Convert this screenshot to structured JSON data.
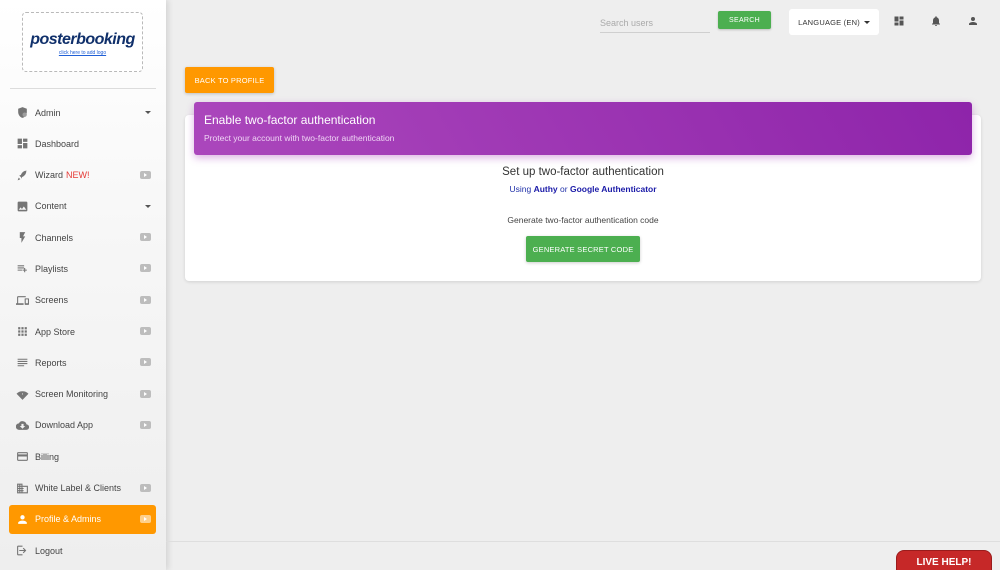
{
  "logo": {
    "name": "posterbooking",
    "link": "click here to add logo"
  },
  "sidebar": {
    "items": [
      {
        "label": "Admin",
        "icon": "shield-gear-icon",
        "right": "caret"
      },
      {
        "label": "Dashboard",
        "icon": "dashboard-icon",
        "right": ""
      },
      {
        "label": "Wizard",
        "new": "NEW!",
        "icon": "rocket-icon",
        "right": "youtube"
      },
      {
        "label": "Content",
        "icon": "image-icon",
        "right": "caret"
      },
      {
        "label": "Channels",
        "icon": "bolt-icon",
        "right": "youtube"
      },
      {
        "label": "Playlists",
        "icon": "playlist-add-icon",
        "right": "youtube"
      },
      {
        "label": "Screens",
        "icon": "devices-icon",
        "right": "youtube"
      },
      {
        "label": "App Store",
        "icon": "apps-grid-icon",
        "right": "youtube"
      },
      {
        "label": "Reports",
        "icon": "reports-icon",
        "right": "youtube"
      },
      {
        "label": "Screen Monitoring",
        "icon": "wifi-monitor-icon",
        "right": "youtube"
      },
      {
        "label": "Download App",
        "icon": "cloud-download-icon",
        "right": "youtube"
      },
      {
        "label": "Billing",
        "icon": "credit-card-icon",
        "right": ""
      },
      {
        "label": "White Label & Clients",
        "icon": "building-icon",
        "right": "youtube"
      },
      {
        "label": "Profile & Admins",
        "icon": "person-icon",
        "right": "youtube",
        "active": true
      },
      {
        "label": "Logout",
        "icon": "logout-icon",
        "right": ""
      }
    ]
  },
  "topbar": {
    "search_placeholder": "Search users",
    "search_button": "SEARCH",
    "language_button": "LANGUAGE (EN)"
  },
  "main": {
    "back_button": "BACK TO PROFILE",
    "card_title": "Enable two-factor authentication",
    "card_subtitle": "Protect your account with two-factor authentication",
    "setup_title": "Set up two-factor authentication",
    "using_prefix": "Using",
    "app1": "Authy",
    "or": "or",
    "app2": "Google Authenticator",
    "generate_label": "Generate two-factor authentication code",
    "generate_button": "GENERATE SECRET CODE"
  },
  "live_help": "LIVE HELP!",
  "colors": {
    "accent": "#ff9800",
    "success": "#4caf50",
    "header": "#9c27b0",
    "live_help": "#c62828"
  }
}
